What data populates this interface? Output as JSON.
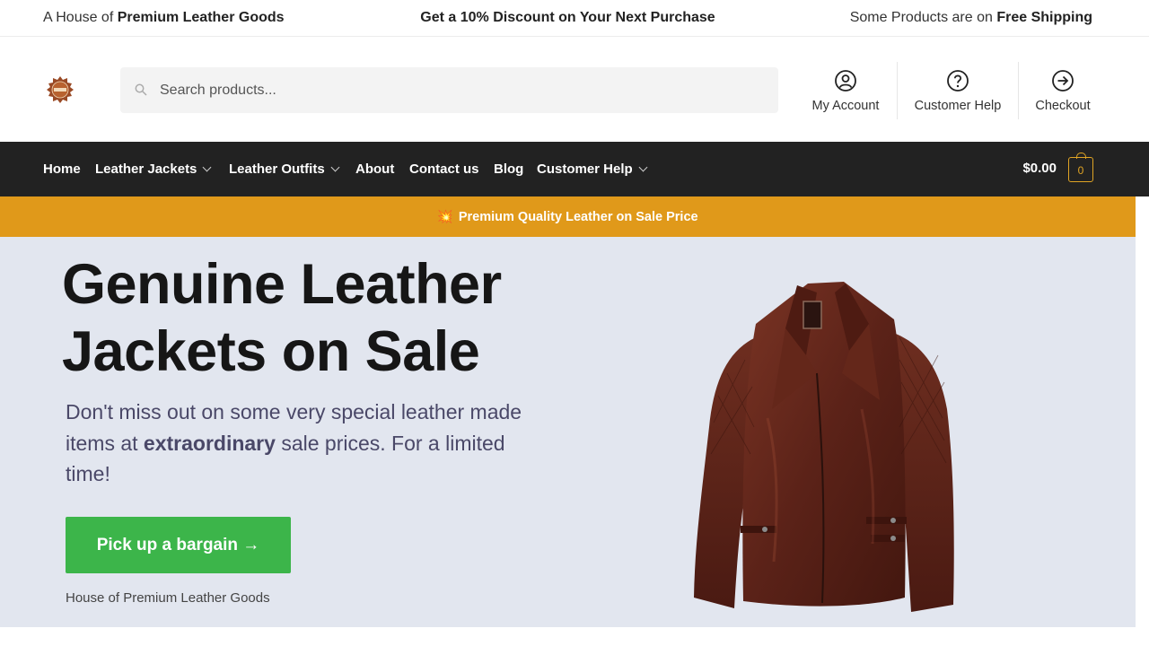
{
  "topbar": {
    "left_prefix": "A House of ",
    "left_bold": "Premium Leather Goods",
    "center": "Get a 10% Discount on Your Next Purchase",
    "right_prefix": "Some Products are on ",
    "right_bold": "Free Shipping"
  },
  "header": {
    "search_placeholder": "Search products...",
    "links": [
      {
        "label": "My Account",
        "icon": "user-circle-icon"
      },
      {
        "label": "Customer Help",
        "icon": "question-circle-icon"
      },
      {
        "label": "Checkout",
        "icon": "arrow-right-circle-icon"
      }
    ]
  },
  "nav": {
    "items": [
      {
        "label": "Home",
        "has_dropdown": false
      },
      {
        "label": "Leather Jackets",
        "has_dropdown": true
      },
      {
        "label": "Leather Outfits",
        "has_dropdown": true
      },
      {
        "label": "About",
        "has_dropdown": false
      },
      {
        "label": "Contact us",
        "has_dropdown": false
      },
      {
        "label": "Blog",
        "has_dropdown": false
      },
      {
        "label": "Customer Help",
        "has_dropdown": true
      }
    ],
    "cart_total": "$0.00",
    "cart_count": "0"
  },
  "promo": {
    "emoji": "💥",
    "text": "Premium Quality Leather on Sale Price"
  },
  "hero": {
    "title_line1": "Genuine Leather",
    "title_line2": "Jackets on Sale",
    "desc_part1": "Don't miss out on some very special leather made items at ",
    "desc_bold": "extraordinary",
    "desc_part2": " sale prices. For a limited time!",
    "cta_label": "Pick up a bargain →",
    "tagline": "House of Premium Leather Goods"
  },
  "colors": {
    "nav_bg": "#222222",
    "promo_bg": "#e0991a",
    "hero_bg": "#e2e6ef",
    "cta_bg": "#3cb54a",
    "accent": "#e0a424"
  }
}
